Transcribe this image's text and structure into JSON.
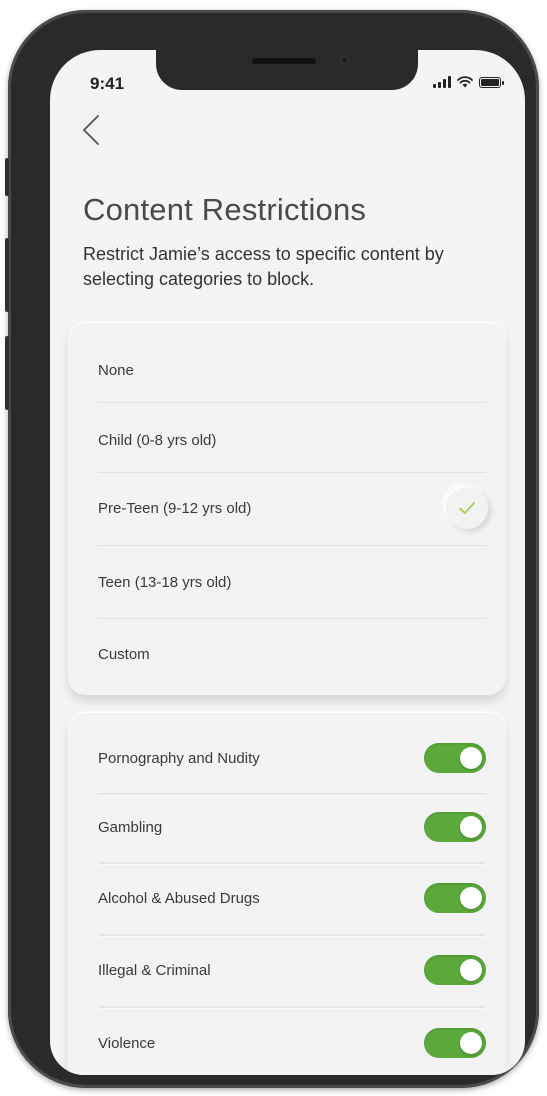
{
  "status_bar": {
    "time": "9:41"
  },
  "header": {
    "back_icon": "chevron-left-icon",
    "title": "Content Restrictions",
    "subtitle": "Restrict Jamie’s access to specific content by selecting categories to block."
  },
  "restriction_levels": {
    "options": [
      {
        "label": "None",
        "selected": false
      },
      {
        "label": "Child (0-8 yrs old)",
        "selected": false
      },
      {
        "label": "Pre-Teen (9-12 yrs old)",
        "selected": true
      },
      {
        "label": "Teen (13-18 yrs old)",
        "selected": false
      },
      {
        "label": "Custom",
        "selected": false
      }
    ],
    "selected_icon": "checkmark-icon"
  },
  "categories": {
    "items": [
      {
        "label": "Pornography and Nudity",
        "enabled": true
      },
      {
        "label": "Gambling",
        "enabled": true
      },
      {
        "label": "Alcohol & Abused Drugs",
        "enabled": true
      },
      {
        "label": "Illegal & Criminal",
        "enabled": true
      },
      {
        "label": "Violence",
        "enabled": true
      }
    ]
  },
  "colors": {
    "toggle_on": "#5aa93a",
    "checkmark": "#9ccb3b",
    "title_text": "#4a4a4a",
    "background": "#f4f4f4"
  }
}
